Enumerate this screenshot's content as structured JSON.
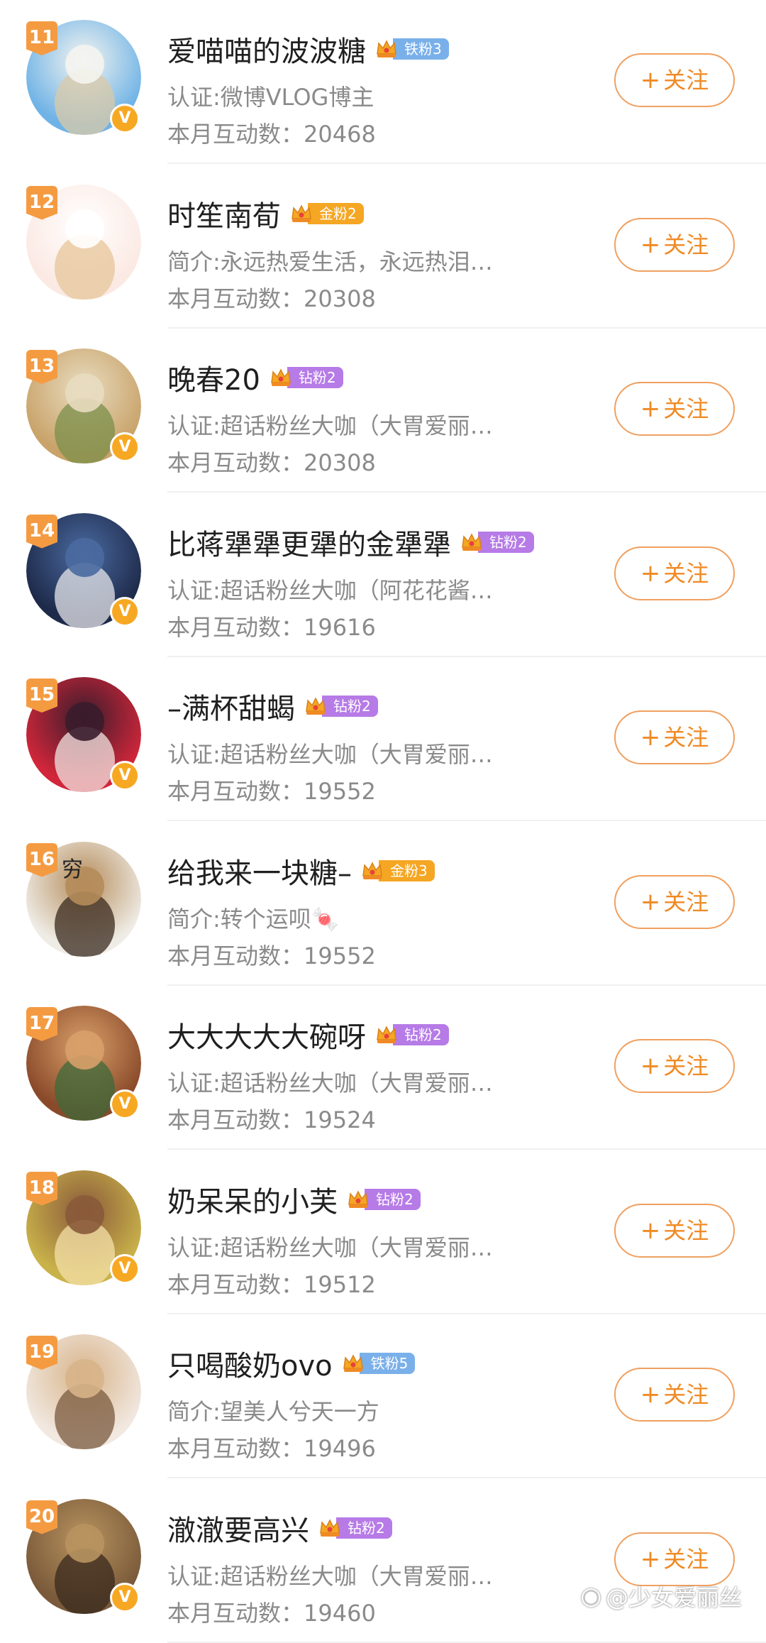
{
  "colors": {
    "accent": "#f08a24",
    "rank_badge": "#f49b42",
    "verified": "#f7a823",
    "tier_iron": "#7ab0ea",
    "tier_gold": "#f5a623",
    "tier_diamond": "#b67be6"
  },
  "users": [
    {
      "rank": "11",
      "name": "爱喵喵的波波糖",
      "tier": "铁粉3",
      "tier_kind": "iron",
      "sub": "认证:微博VLOG博主",
      "stat_label": "本月互动数：",
      "stat_value": "20468",
      "verified": true,
      "follow": "关注",
      "avatar_colors": [
        "#6fb3e6",
        "#f4f4f0",
        "#d9c9a8"
      ]
    },
    {
      "rank": "12",
      "name": "时笙南荀",
      "tier": "金粉2",
      "tier_kind": "gold",
      "sub": "简介:永远热爱生活，永远热泪…",
      "stat_label": "本月互动数：",
      "stat_value": "20308",
      "verified": false,
      "follow": "关注",
      "avatar_colors": [
        "#fbe9e3",
        "#ffffff",
        "#e7c59a"
      ]
    },
    {
      "rank": "13",
      "name": "晚春20",
      "tier": "钻粉2",
      "tier_kind": "diamond",
      "sub": "认证:超话粉丝大咖（大胃爱丽…",
      "stat_label": "本月互动数：",
      "stat_value": "20308",
      "verified": true,
      "follow": "关注",
      "avatar_colors": [
        "#c9a36a",
        "#e8dcc0",
        "#7b8f4a"
      ]
    },
    {
      "rank": "14",
      "name": "比蒋犟犟更犟的金犟犟",
      "tier": "钻粉2",
      "tier_kind": "diamond",
      "sub": "认证:超话粉丝大咖（阿花花酱…",
      "stat_label": "本月互动数：",
      "stat_value": "19616",
      "verified": true,
      "follow": "关注",
      "avatar_colors": [
        "#1e2a4a",
        "#4a6aa0",
        "#e6e6ea"
      ]
    },
    {
      "rank": "15",
      "name": "–满杯甜蝎",
      "tier": "钻粉2",
      "tier_kind": "diamond",
      "sub": "认证:超话粉丝大咖（大胃爱丽…",
      "stat_label": "本月互动数：",
      "stat_value": "19552",
      "verified": true,
      "follow": "关注",
      "avatar_colors": [
        "#d2263a",
        "#3a1c2c",
        "#f2e4e2"
      ]
    },
    {
      "rank": "16",
      "name": "给我来一块糖–",
      "tier": "金粉3",
      "tier_kind": "gold",
      "sub": "简介:转个运呗🍬",
      "stat_label": "本月互动数：",
      "stat_value": "19552",
      "verified": false,
      "follow": "关注",
      "avatar_colors": [
        "#efece6",
        "#b58c5a",
        "#3a2a1e"
      ],
      "avatar_text": "穷"
    },
    {
      "rank": "17",
      "name": "大大大大大碗呀",
      "tier": "钻粉2",
      "tier_kind": "diamond",
      "sub": "认证:超话粉丝大咖（大胃爱丽…",
      "stat_label": "本月互动数：",
      "stat_value": "19524",
      "verified": true,
      "follow": "关注",
      "avatar_colors": [
        "#8a4a2a",
        "#d9a06a",
        "#3e6a3a"
      ]
    },
    {
      "rank": "18",
      "name": "奶呆呆的小芙",
      "tier": "钻粉2",
      "tier_kind": "diamond",
      "sub": "认证:超话粉丝大咖（大胃爱丽…",
      "stat_label": "本月互动数：",
      "stat_value": "19512",
      "verified": true,
      "follow": "关注",
      "avatar_colors": [
        "#c9b24a",
        "#8a5a3a",
        "#f4e0a8"
      ]
    },
    {
      "rank": "19",
      "name": "只喝酸奶ovo",
      "tier": "铁粉5",
      "tier_kind": "iron",
      "sub": "简介:望美人兮天一方",
      "stat_label": "本月互动数：",
      "stat_value": "19496",
      "verified": false,
      "follow": "关注",
      "avatar_colors": [
        "#f1e8e0",
        "#d8b48a",
        "#7a5a3e"
      ]
    },
    {
      "rank": "20",
      "name": "澈澈要高兴",
      "tier": "钻粉2",
      "tier_kind": "diamond",
      "sub": "认证:超话粉丝大咖（大胃爱丽…",
      "stat_label": "本月互动数：",
      "stat_value": "19460",
      "verified": true,
      "follow": "关注",
      "avatar_colors": [
        "#7a5a3a",
        "#b8935f",
        "#3a2a1e"
      ]
    }
  ],
  "icons": {
    "follow_plus": "plus-icon",
    "crown": "crown-icon",
    "verified": "verified-v-icon"
  },
  "watermark": {
    "icon": "weibo-icon",
    "text": "@少女爱丽丝"
  }
}
